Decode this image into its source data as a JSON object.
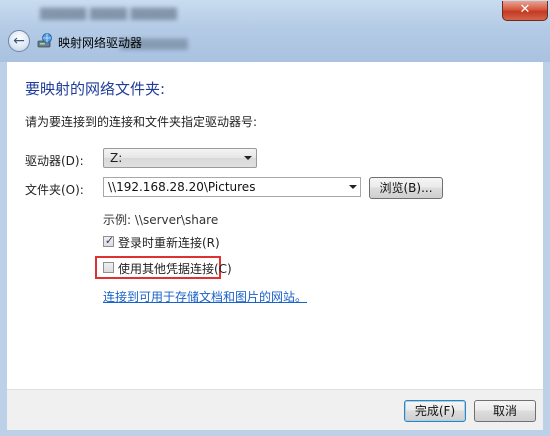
{
  "window": {
    "title": "映射网络驱动器",
    "close_label": "✕"
  },
  "main": {
    "heading": "要映射的网络文件夹:",
    "instruction": "请为要连接到的连接和文件夹指定驱动器号:",
    "drive": {
      "label": "驱动器(D):",
      "value": "Z:"
    },
    "folder": {
      "label": "文件夹(O):",
      "value": "\\\\192.168.28.20\\Pictures"
    },
    "browse_label": "浏览(B)...",
    "example": "示例: \\\\server\\share",
    "reconnect": {
      "label": "登录时重新连接(R)",
      "checked": true
    },
    "other_credentials": {
      "label": "使用其他凭据连接(C)",
      "checked": false
    },
    "link_text": "连接到可用于存储文档和图片的网站"
  },
  "footer": {
    "finish_label": "完成(F)",
    "cancel_label": "取消"
  },
  "colors": {
    "heading": "#1f3d99",
    "link": "#1862c8",
    "highlight": "#e03030"
  }
}
